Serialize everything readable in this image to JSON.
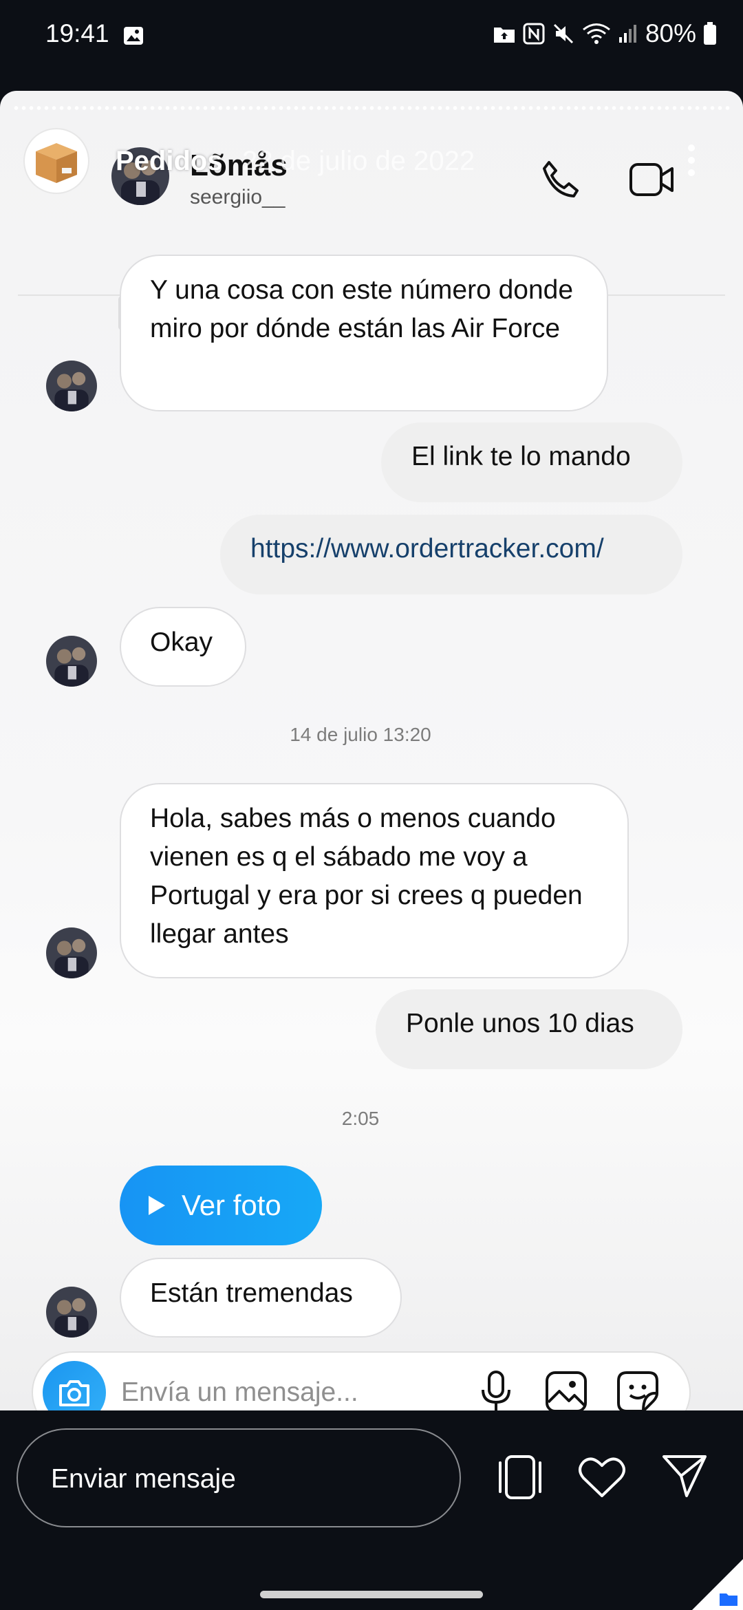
{
  "status_bar": {
    "time": "19:41",
    "battery": "80%"
  },
  "story": {
    "user": "Pedidos",
    "date": "22 de julio de 2022"
  },
  "chat": {
    "contact_name": "Lõmås",
    "contact_handle": "seergiio__",
    "messages": [
      {
        "text": "Y una cosa con este número donde miro por dónde están las Air Force"
      },
      {
        "text": "El link te lo mando"
      },
      {
        "text": "https://www.ordertracker.com/"
      },
      {
        "text": "Okay"
      },
      {
        "text": "14 de julio 13:20"
      },
      {
        "text": "Hola, sabes más o menos cuando vienen es q el sábado me voy a Portugal y era por si crees q pueden llegar antes"
      },
      {
        "text": "Ponle unos 10 dias"
      },
      {
        "text": "2:05"
      },
      {
        "text": "Ver foto"
      },
      {
        "text": "Están tremendas"
      }
    ],
    "composer_placeholder": "Envía un mensaje..."
  },
  "reply_bar": {
    "placeholder": "Enviar mensaje"
  },
  "colors": {
    "accent": "#1794f4",
    "link": "#16406b",
    "background": "#0c0f15"
  }
}
